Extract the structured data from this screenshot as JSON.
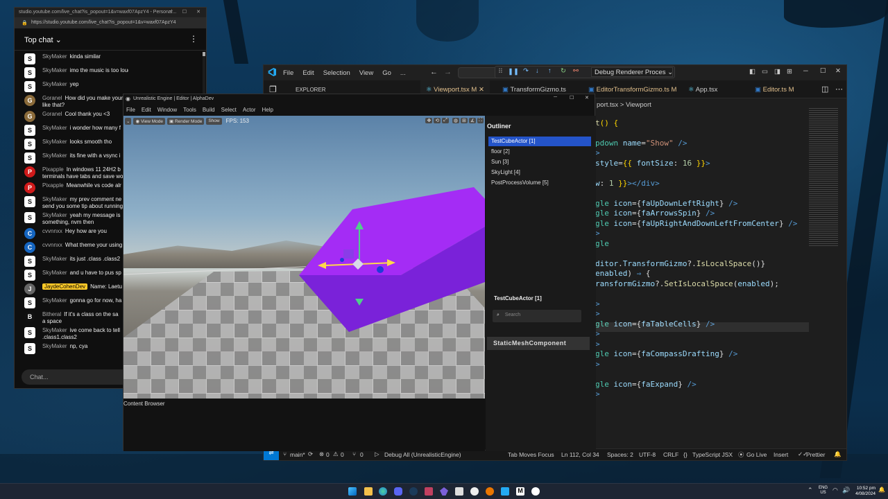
{
  "chat": {
    "tab_title": "studio.youtube.com/live_chat?is_popout=1&v=waxf07ApzY4 - Personal...",
    "url": "https://studio.youtube.com/live_chat?is_popout=1&v=waxf07ApzY4",
    "header": "Top chat",
    "input_placeholder": "Chat...",
    "messages": [
      {
        "author": "SkyMaker",
        "text": "kinda similar",
        "av": "S",
        "c": "#fff"
      },
      {
        "author": "SkyMaker",
        "text": "imo the music is too loud or youre too quiet m",
        "av": "S",
        "c": "#fff"
      },
      {
        "author": "SkyMaker",
        "text": "yep",
        "av": "S",
        "c": "#fff"
      },
      {
        "author": "Goranel",
        "text": "How did you make your",
        "text2": "like that?",
        "av": "G",
        "c": "#8b6b3a"
      },
      {
        "author": "Goranel",
        "text": "Cool thank you <3",
        "av": "G",
        "c": "#8b6b3a"
      },
      {
        "author": "SkyMaker",
        "text": "i wonder how many f",
        "av": "S",
        "c": "#fff"
      },
      {
        "author": "SkyMaker",
        "text": "looks smooth tho",
        "av": "S",
        "c": "#fff"
      },
      {
        "author": "SkyMaker",
        "text": "its fine with a vsync i",
        "av": "S",
        "c": "#fff"
      },
      {
        "author": "Pixapple",
        "text": "In windows 11 24H2 b",
        "text2": "terminals have tabs and save wo",
        "av": "P",
        "c": "#d01a1a"
      },
      {
        "author": "Pixapple",
        "text": "Meanwhile vs code alr",
        "av": "P",
        "c": "#d01a1a"
      },
      {
        "author": "SkyMaker",
        "text": "my prev comment ne",
        "text2": "send you some tip about running",
        "av": "S",
        "c": "#fff"
      },
      {
        "author": "SkyMaker",
        "text": "yeah my message is",
        "text2": "something, nvm then",
        "av": "S",
        "c": "#fff"
      },
      {
        "author": "cvvnnxx",
        "text": "Hey how are you",
        "av": "C",
        "c": "#1565c0"
      },
      {
        "author": "cvvnnxx",
        "text": "What theme your using",
        "av": "C",
        "c": "#1565c0"
      },
      {
        "author": "SkyMaker",
        "text": "its just .class .class2",
        "av": "S",
        "c": "#fff"
      },
      {
        "author": "SkyMaker",
        "text": "and u have to pus sp",
        "av": "S",
        "c": "#fff"
      },
      {
        "author": "JaydeCohenDev",
        "text": "Name: Laetu",
        "av": "J",
        "c": "#666",
        "highlight": true
      },
      {
        "author": "SkyMaker",
        "text": "gonna go for now, ha",
        "av": "S",
        "c": "#fff"
      },
      {
        "author": "Bitheral",
        "text": "If it's a class on the sa",
        "text2": "a space",
        "av": "B",
        "c": "#111"
      },
      {
        "author": "SkyMaker",
        "text": "ive come back to tell",
        "text2": ".class1.class2",
        "av": "S",
        "c": "#fff"
      },
      {
        "author": "SkyMaker",
        "text": "np, cya",
        "av": "S",
        "c": "#fff"
      }
    ]
  },
  "vscode": {
    "menu": [
      "File",
      "Edit",
      "Selection",
      "View",
      "Go",
      "..."
    ],
    "debug_config": "Debug Renderer Proces",
    "explorer_label": "EXPLORER",
    "tabs": [
      "Viewport.tsx M",
      "TransformGizmo.ts",
      "EditorTransformGizmo.ts M",
      "App.tsx",
      "Editor.ts M"
    ],
    "breadcrumb": "port.tsx > Viewport",
    "status": {
      "branch": "main*",
      "errors": "0",
      "warnings": "0",
      "ports": "0",
      "debug": "Debug All (UnrealisticEngine)",
      "tab_focus": "Tab Moves Focus",
      "position": "Ln 112, Col 34",
      "spaces": "Spaces: 2",
      "encoding": "UTF-8",
      "eol": "CRLF",
      "language": "TypeScript JSX",
      "golive": "Go Live",
      "insert": "Insert",
      "prettier": "Prettier"
    }
  },
  "engine": {
    "title": "Unrealistic Engine | Editor | AlphaDev",
    "menu": [
      "File",
      "Edit",
      "Window",
      "Tools",
      "Build",
      "Select",
      "Actor",
      "Help"
    ],
    "view_mode": "View Mode",
    "render_mode": "Render Mode",
    "show": "Show",
    "fps": "FPS: 153",
    "outliner_title": "Outliner",
    "outliner_items": [
      "TestCubeActor [1]",
      "floor [2]",
      "Sun [3]",
      "SkyLight [4]",
      "PostProcessVolume [5]"
    ],
    "selected_actor": "TestCubeActor [1]",
    "search_placeholder": "Search",
    "component": "StaticMeshComponent",
    "content_browser": "Content Browser"
  },
  "taskbar": {
    "lang": "ENG",
    "region": "US",
    "time": "10:52 pm",
    "date": "4/08/2024"
  }
}
